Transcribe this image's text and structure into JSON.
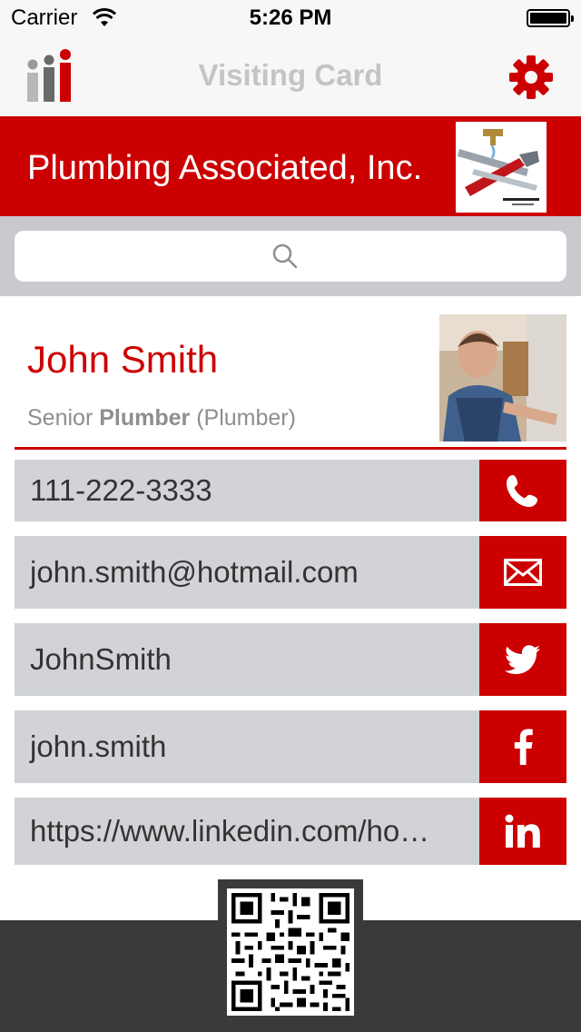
{
  "status_bar": {
    "carrier": "Carrier",
    "time": "5:26 PM"
  },
  "nav": {
    "title": "Visiting Card",
    "settings_icon": "gear-icon"
  },
  "company": {
    "name": "Plumbing Associated, Inc."
  },
  "search": {
    "icon": "search-icon"
  },
  "profile": {
    "name": "John Smith",
    "title_prefix": "Senior",
    "title_role": "Plumber",
    "title_suffix": "(Plumber)"
  },
  "contacts": [
    {
      "type": "phone",
      "value": "111-222-3333",
      "icon": "phone-icon"
    },
    {
      "type": "email",
      "value": "john.smith@hotmail.com",
      "icon": "email-icon"
    },
    {
      "type": "twitter",
      "value": "JohnSmith",
      "icon": "twitter-icon"
    },
    {
      "type": "facebook",
      "value": "john.smith",
      "icon": "facebook-icon"
    },
    {
      "type": "linkedin",
      "value": "https://www.linkedin.com/ho…",
      "icon": "linkedin-icon"
    }
  ],
  "colors": {
    "accent": "#cc0000",
    "row_bg": "#d1d3d6",
    "footer": "#3a3a3a",
    "nav_title": "#c4c4c4"
  }
}
